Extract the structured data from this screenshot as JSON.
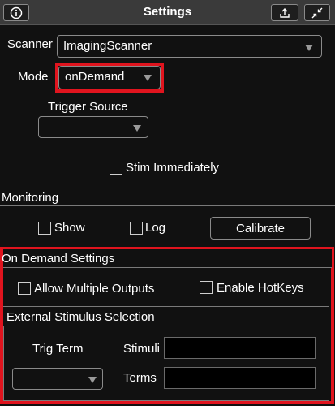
{
  "window": {
    "title": "Settings",
    "info_icon": "info-icon",
    "export_icon": "export-icon",
    "collapse_icon": "collapse-icon"
  },
  "scanner": {
    "label": "Scanner",
    "value": "ImagingScanner"
  },
  "mode": {
    "label": "Mode",
    "value": "onDemand"
  },
  "trigger_source": {
    "label": "Trigger Source",
    "value": ""
  },
  "stim_immediately": {
    "label": "Stim Immediately",
    "checked": false
  },
  "monitoring": {
    "header": "Monitoring",
    "show_label": "Show",
    "show_checked": false,
    "log_label": "Log",
    "log_checked": false,
    "calibrate_label": "Calibrate"
  },
  "on_demand": {
    "header": "On Demand Settings",
    "allow_multiple_outputs_label": "Allow Multiple Outputs",
    "allow_multiple_outputs_checked": false,
    "enable_hotkeys_label": "Enable HotKeys",
    "enable_hotkeys_checked": false
  },
  "external_stimulus": {
    "header": "External Stimulus Selection",
    "trig_term_label": "Trig Term",
    "trig_term_value": "",
    "stimuli_label": "Stimuli",
    "stimuli_value": "",
    "terms_label": "Terms",
    "terms_value": ""
  },
  "colors": {
    "highlight": "#e0141e",
    "background": "#111111",
    "titlebar": "#3a3a3a"
  }
}
